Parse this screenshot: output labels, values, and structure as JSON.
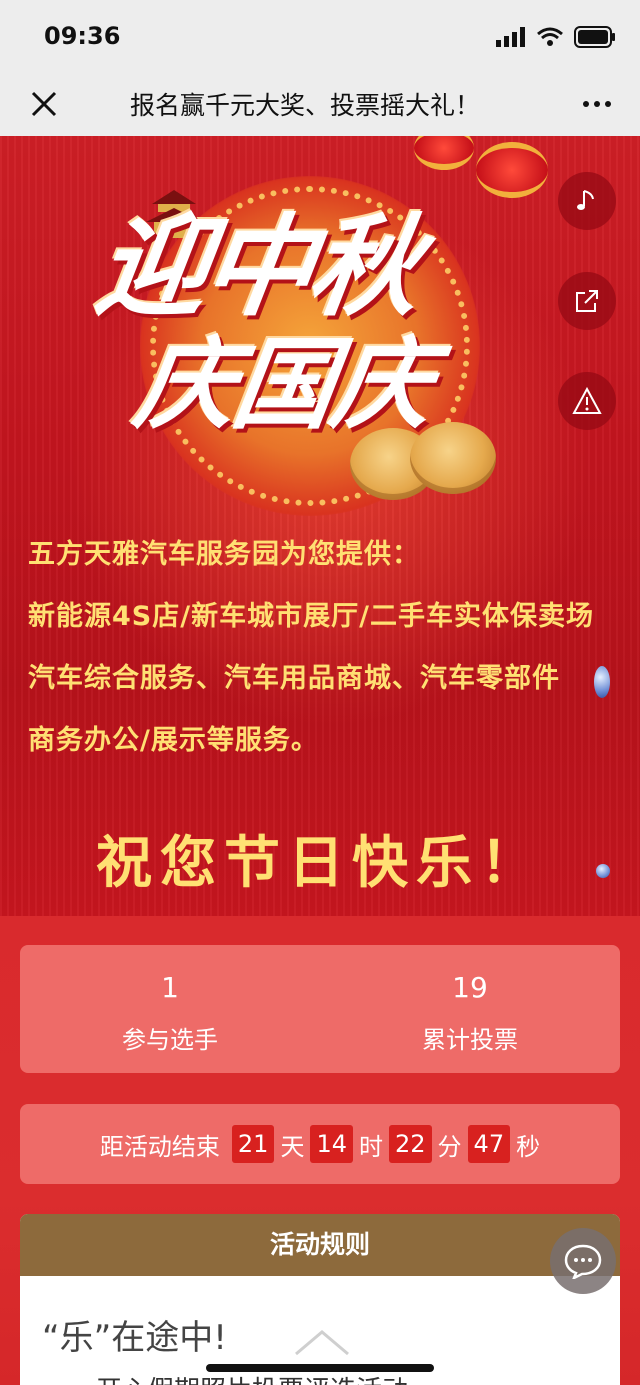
{
  "status_bar": {
    "time": "09:36"
  },
  "nav": {
    "title": "报名赢千元大奖、投票摇大礼！",
    "close_icon": "close-icon",
    "more_icon": "more-icon"
  },
  "banner": {
    "headline_line1": "迎中秋",
    "headline_line2": "庆国庆",
    "description": [
      "五方天雅汽车服务园为您提供：",
      "新能源4S店/新车城市展厅/二手车实体保卖场",
      "汽车综合服务、汽车用品商城、汽车零部件",
      "商务办公/展示等服务。"
    ],
    "wish": "祝您节日快乐！",
    "side_buttons": [
      "music-icon",
      "share-icon",
      "report-icon"
    ]
  },
  "stats": [
    {
      "value": "1",
      "label": "参与选手"
    },
    {
      "value": "19",
      "label": "累计投票"
    }
  ],
  "countdown": {
    "prefix": "距活动结束",
    "days": "21",
    "days_unit": "天",
    "hours": "14",
    "hours_unit": "时",
    "minutes": "22",
    "minutes_unit": "分",
    "seconds": "47",
    "seconds_unit": "秒"
  },
  "rules": {
    "header": "活动规则",
    "title": "“乐”在途中!",
    "subtitle": "开心假期照片投票评选活动"
  },
  "colors": {
    "banner_red": "#c4151f",
    "accent_gold": "#ffe073",
    "rules_brown": "#8d6a3c",
    "card_pink": "#ee6b68"
  }
}
